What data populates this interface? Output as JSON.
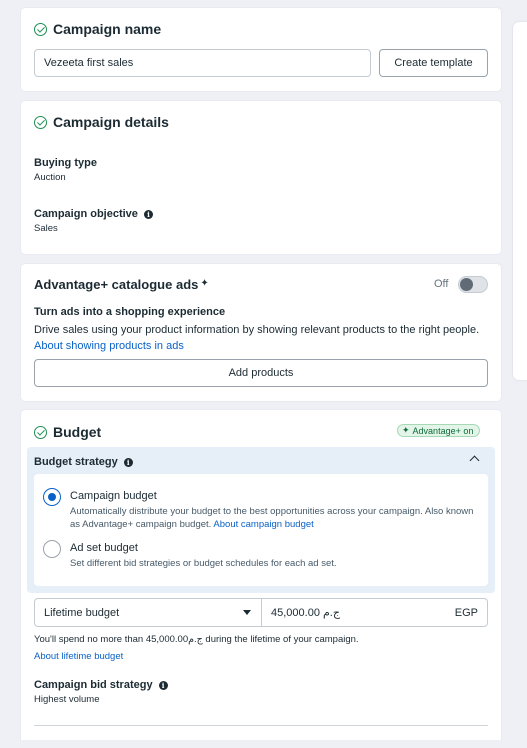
{
  "campaign_name": {
    "title": "Campaign name",
    "input_value": "Vezeeta first sales",
    "create_template_label": "Create template"
  },
  "campaign_details": {
    "title": "Campaign details",
    "buying_type_label": "Buying type",
    "buying_type_value": "Auction",
    "objective_label": "Campaign objective",
    "objective_value": "Sales"
  },
  "advantage_catalogue": {
    "title": "Advantage+ catalogue ads",
    "toggle_state_label": "Off",
    "toggle_on": false,
    "subtitle": "Turn ads into a shopping experience",
    "description": "Drive sales using your product information by showing relevant products to the right people.",
    "link_text": "About showing products in ads",
    "add_products_label": "Add products"
  },
  "budget": {
    "title": "Budget",
    "badge_label": "Advantage+ on",
    "strategy_heading": "Budget strategy",
    "options": [
      {
        "title": "Campaign budget",
        "description": "Automatically distribute your budget to the best opportunities across your campaign. Also known as Advantage+ campaign budget.",
        "link_text": "About campaign budget",
        "selected": true
      },
      {
        "title": "Ad set budget",
        "description": "Set different bid strategies or budget schedules for each ad set.",
        "link_text": "",
        "selected": false
      }
    ],
    "budget_type_value": "Lifetime budget",
    "amount_value": "ج.م 45,000.00",
    "currency": "EGP",
    "spend_note": "You'll spend no more than 45,000.00ج.م during the lifetime of your campaign.",
    "spend_link": "About lifetime budget",
    "bid_strategy_label": "Campaign bid strategy",
    "bid_strategy_value": "Highest volume"
  },
  "colors": {
    "accent_blue": "#0a62c7",
    "success_green": "#1e8e52",
    "strategy_bg": "#e6eef7"
  }
}
